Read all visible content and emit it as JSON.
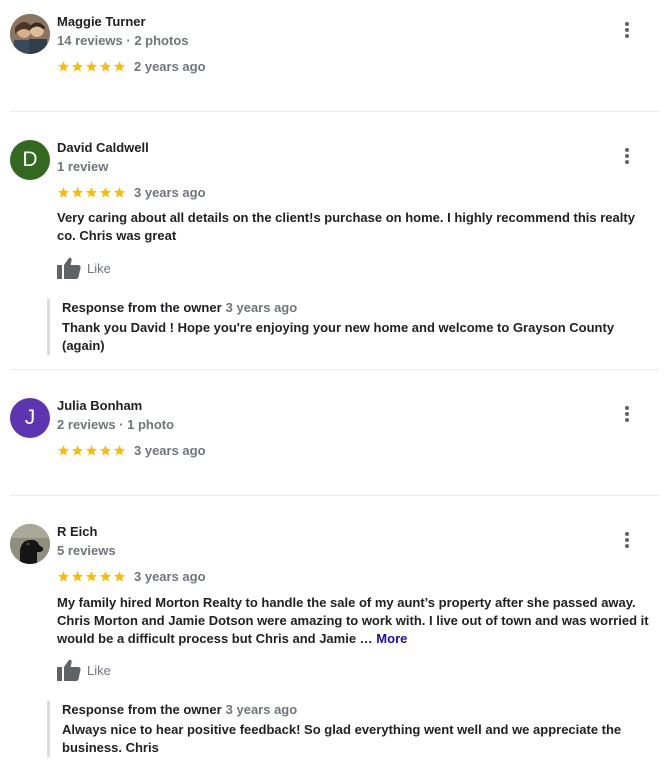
{
  "reviews": [
    {
      "name": "Maggie Turner",
      "meta": "14 reviews · 2 photos",
      "date": "2 years ago",
      "avatar": {
        "type": "photo",
        "color": "#6b5a4a"
      }
    },
    {
      "name": "David Caldwell",
      "meta": "1 review",
      "date": "3 years ago",
      "avatar": {
        "type": "letter",
        "letter": "D",
        "color": "#33691e"
      },
      "text": "Very caring about all details on the client!s purchase on home. I highly recommend this realty co. Chris was great",
      "like_label": "Like",
      "response": {
        "label": "Response from the owner",
        "date": "3 years ago",
        "text": "Thank you David ! Hope you're enjoying your new home and welcome to Grayson County (again)"
      }
    },
    {
      "name": "Julia Bonham",
      "meta": "2 reviews · 1 photo",
      "date": "3 years ago",
      "avatar": {
        "type": "letter",
        "letter": "J",
        "color": "#5e35b1"
      }
    },
    {
      "name": "R Eich",
      "meta": "5 reviews",
      "date": "3 years ago",
      "avatar": {
        "type": "photo",
        "color": "#7a7a6a"
      },
      "text": "My family hired Morton Realty to handle the sale of my aunt’s property after she passed away. Chris Morton and Jamie Dotson were amazing to work with.  I live out of town and was worried it would be a difficult process but Chris and Jamie …",
      "more_label": "More",
      "like_label": "Like",
      "response": {
        "label": "Response from the owner",
        "date": "3 years ago",
        "text": "Always nice to hear positive feedback! So glad everything went well and we appreciate the business. Chris"
      }
    }
  ],
  "star_rating": 5,
  "colors": {
    "star": "#fbbc04",
    "text": "#202124",
    "secondary": "#70757a",
    "link": "#1a0dab",
    "icon": "#5f6368"
  }
}
